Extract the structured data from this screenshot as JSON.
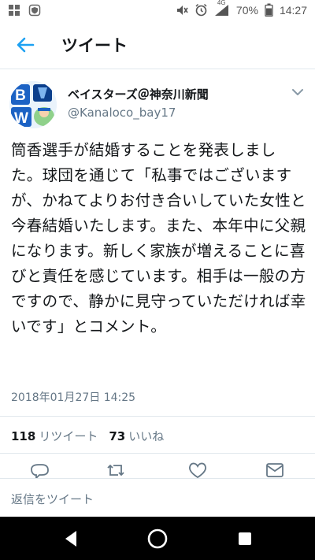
{
  "status_bar": {
    "icons": [
      "grid-icon",
      "shield-icon",
      "mute-icon",
      "alarm-icon",
      "signal-icon"
    ],
    "network": "4G",
    "battery": "70%",
    "time": "14:27"
  },
  "app_bar": {
    "back_icon": "arrow-left-icon",
    "title": "ツイート"
  },
  "author": {
    "name": "ベイスターズ＠神奈川新聞",
    "handle": "@Kanaloco_bay17",
    "avatar_letters": [
      "B",
      "W"
    ]
  },
  "tweet": {
    "text": "筒香選手が結婚することを発表しました。球団を通じて「私事ではございますが、かねてよりお付き合いしていた女性と今春結婚いたします。また、本年中に父親になります。新しく家族が増えることに喜びと責任を感じています。相手は一般の方ですので、静かに見守っていただければ幸いです」とコメント。",
    "timestamp": "2018年01月27日 14:25"
  },
  "stats": {
    "retweets_count": "118",
    "retweets_label": "リツイート",
    "likes_count": "73",
    "likes_label": "いいね"
  },
  "reply": {
    "placeholder": "返信をツイート"
  },
  "colors": {
    "accent": "#1da1f2",
    "text": "#14171a",
    "secondary": "#657786",
    "divider": "#e1e8ed"
  }
}
